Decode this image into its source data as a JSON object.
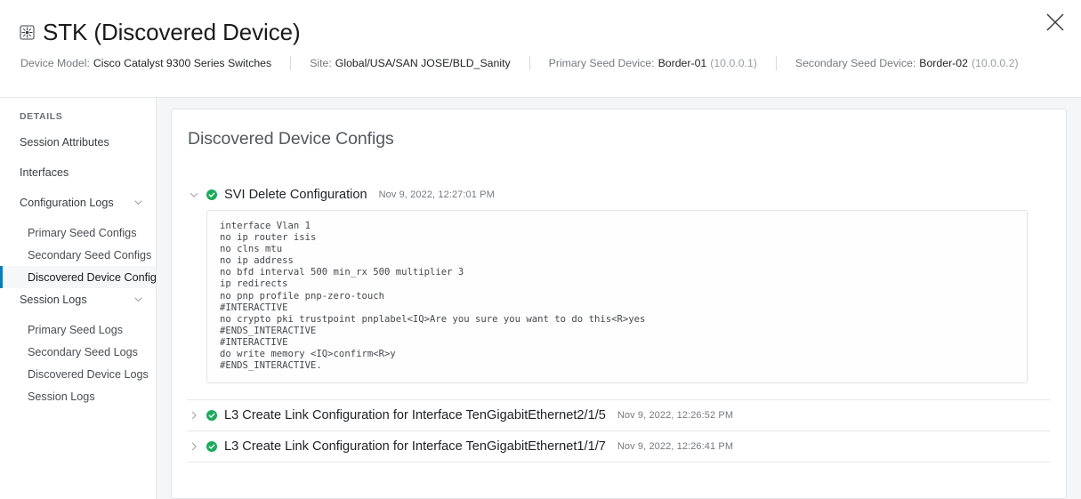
{
  "header": {
    "device_icon": "switch-stack-icon",
    "title": "STK (Discovered Device)",
    "close_icon": "close-icon",
    "meta": [
      {
        "label": "Device Model:",
        "value": "Cisco Catalyst 9300 Series Switches",
        "sub": ""
      },
      {
        "label": "Site:",
        "value": "Global/USA/SAN JOSE/BLD_Sanity",
        "sub": ""
      },
      {
        "label": "Primary Seed Device:",
        "value": "Border-01",
        "sub": "(10.0.0.1)"
      },
      {
        "label": "Secondary Seed Device:",
        "value": "Border-02",
        "sub": "(10.0.0.2)"
      }
    ]
  },
  "sidebar": {
    "heading": "DETAILS",
    "accent_color": "#0d7bc0",
    "items": [
      {
        "label": "Session Attributes",
        "sub": false,
        "expandable": false,
        "active": false
      },
      {
        "label": "Interfaces",
        "sub": false,
        "expandable": false,
        "active": false
      },
      {
        "label": "Configuration Logs",
        "sub": false,
        "expandable": true,
        "active": false
      },
      {
        "label": "Primary Seed Configs",
        "sub": true,
        "expandable": false,
        "active": false
      },
      {
        "label": "Secondary Seed Configs",
        "sub": true,
        "expandable": false,
        "active": false
      },
      {
        "label": "Discovered Device Configs",
        "sub": true,
        "expandable": false,
        "active": true
      },
      {
        "label": "Session Logs",
        "sub": false,
        "expandable": true,
        "active": false
      },
      {
        "label": "Primary Seed Logs",
        "sub": true,
        "expandable": false,
        "active": false
      },
      {
        "label": "Secondary Seed Logs",
        "sub": true,
        "expandable": false,
        "active": false
      },
      {
        "label": "Discovered Device Logs",
        "sub": true,
        "expandable": false,
        "active": false
      },
      {
        "label": "Session Logs",
        "sub": true,
        "expandable": false,
        "active": false
      }
    ]
  },
  "main": {
    "title": "Discovered Device Configs",
    "status_color": "#1daa5c",
    "sections": [
      {
        "label": "SVI Delete Configuration",
        "timestamp": "Nov 9, 2022, 12:27:01 PM",
        "expanded": true,
        "status": "success",
        "config": "interface Vlan 1\nno ip router isis\nno clns mtu\nno ip address\nno bfd interval 500 min_rx 500 multiplier 3\nip redirects\nno pnp profile pnp-zero-touch\n#INTERACTIVE\nno crypto pki trustpoint pnplabel<IQ>Are you sure you want to do this<R>yes\n#ENDS_INTERACTIVE\n#INTERACTIVE\ndo write memory <IQ>confirm<R>y\n#ENDS_INTERACTIVE."
      },
      {
        "label": "L3 Create Link Configuration for Interface TenGigabitEthernet2/1/5",
        "timestamp": "Nov 9, 2022, 12:26:52 PM",
        "expanded": false,
        "status": "success",
        "config": ""
      },
      {
        "label": "L3 Create Link Configuration for Interface TenGigabitEthernet1/1/7",
        "timestamp": "Nov 9, 2022, 12:26:41 PM",
        "expanded": false,
        "status": "success",
        "config": ""
      }
    ]
  }
}
